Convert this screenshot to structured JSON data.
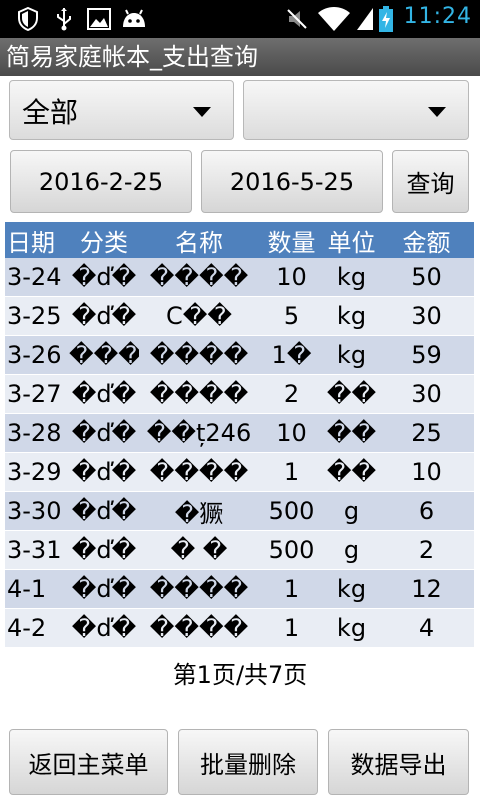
{
  "status_bar": {
    "icons": [
      "shield-icon",
      "usb-icon",
      "image-icon",
      "android-icon",
      "mute-icon",
      "wifi-icon",
      "battery-charging-icon"
    ],
    "time": "11:24",
    "accent": "#33b5e5"
  },
  "title": "简易家庭帐本_支出查询",
  "filters": {
    "category_spinner": "全部",
    "sub_spinner": "",
    "start_date": "2016-2-25",
    "end_date": "2016-5-25",
    "query_button": "查询"
  },
  "table": {
    "headers": [
      "日期",
      "分类",
      "名称",
      "数量",
      "单位",
      "金额"
    ],
    "header_color": "#4f81bd",
    "rows": [
      [
        "3-24",
        "�ď�",
        "����",
        "10",
        "kg",
        "50"
      ],
      [
        "3-25",
        "�ď�",
        "C��",
        "5",
        "kg",
        "30"
      ],
      [
        "3-26",
        "����",
        "����",
        "1�",
        "kg",
        "59"
      ],
      [
        "3-27",
        "�ď�",
        "����",
        "2",
        "��",
        "30"
      ],
      [
        "3-28",
        "�ď�",
        "��ț246",
        "10",
        "��",
        "25"
      ],
      [
        "3-29",
        "�ď�",
        "����",
        "1",
        "��",
        "10"
      ],
      [
        "3-30",
        "�ď�",
        "�獗",
        "500",
        "g",
        "6"
      ],
      [
        "3-31",
        "�ď�",
        "� �",
        "500",
        "g",
        "2"
      ],
      [
        "4-1",
        "�ď�",
        "����",
        "1",
        "kg",
        "12"
      ],
      [
        "4-2",
        "�ď�",
        "����",
        "1",
        "kg",
        "4"
      ]
    ]
  },
  "pager": "第1页/共7页",
  "bottom_buttons": {
    "back": "返回主菜单",
    "batch_delete": "批量删除",
    "export": "数据导出"
  }
}
